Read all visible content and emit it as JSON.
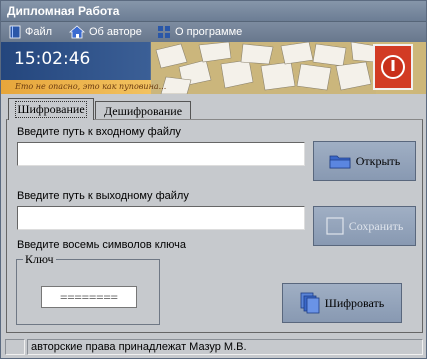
{
  "window": {
    "title": "Дипломная Работа"
  },
  "menu": {
    "items": [
      {
        "label": "Файл",
        "icon": "book-icon"
      },
      {
        "label": "Об авторе",
        "icon": "house-icon"
      },
      {
        "label": "О программе",
        "icon": "windows-icon"
      }
    ]
  },
  "banner": {
    "time": "15:02:46",
    "script_text": "Ето не опасно, это как пуповина..."
  },
  "tabs": [
    {
      "label": "Шифрование",
      "active": true
    },
    {
      "label": "Дешифрование",
      "active": false
    }
  ],
  "form": {
    "input_label": "Введите путь к входному файлу",
    "input_value": "",
    "open_button": "Открыть",
    "output_label": "Введите путь к выходному файлу",
    "output_value": "",
    "save_button": "Сохранить",
    "key_label": "Введите восемь символов ключа",
    "key_group_label": "Ключ",
    "key_value": "========",
    "encrypt_button": "Шифровать"
  },
  "status": {
    "copyright": "авторские права принадлежат Мазур М.В."
  },
  "colors": {
    "accent": "#8899b2",
    "power": "#d23b24",
    "window_bg": "#c6c9cd"
  }
}
